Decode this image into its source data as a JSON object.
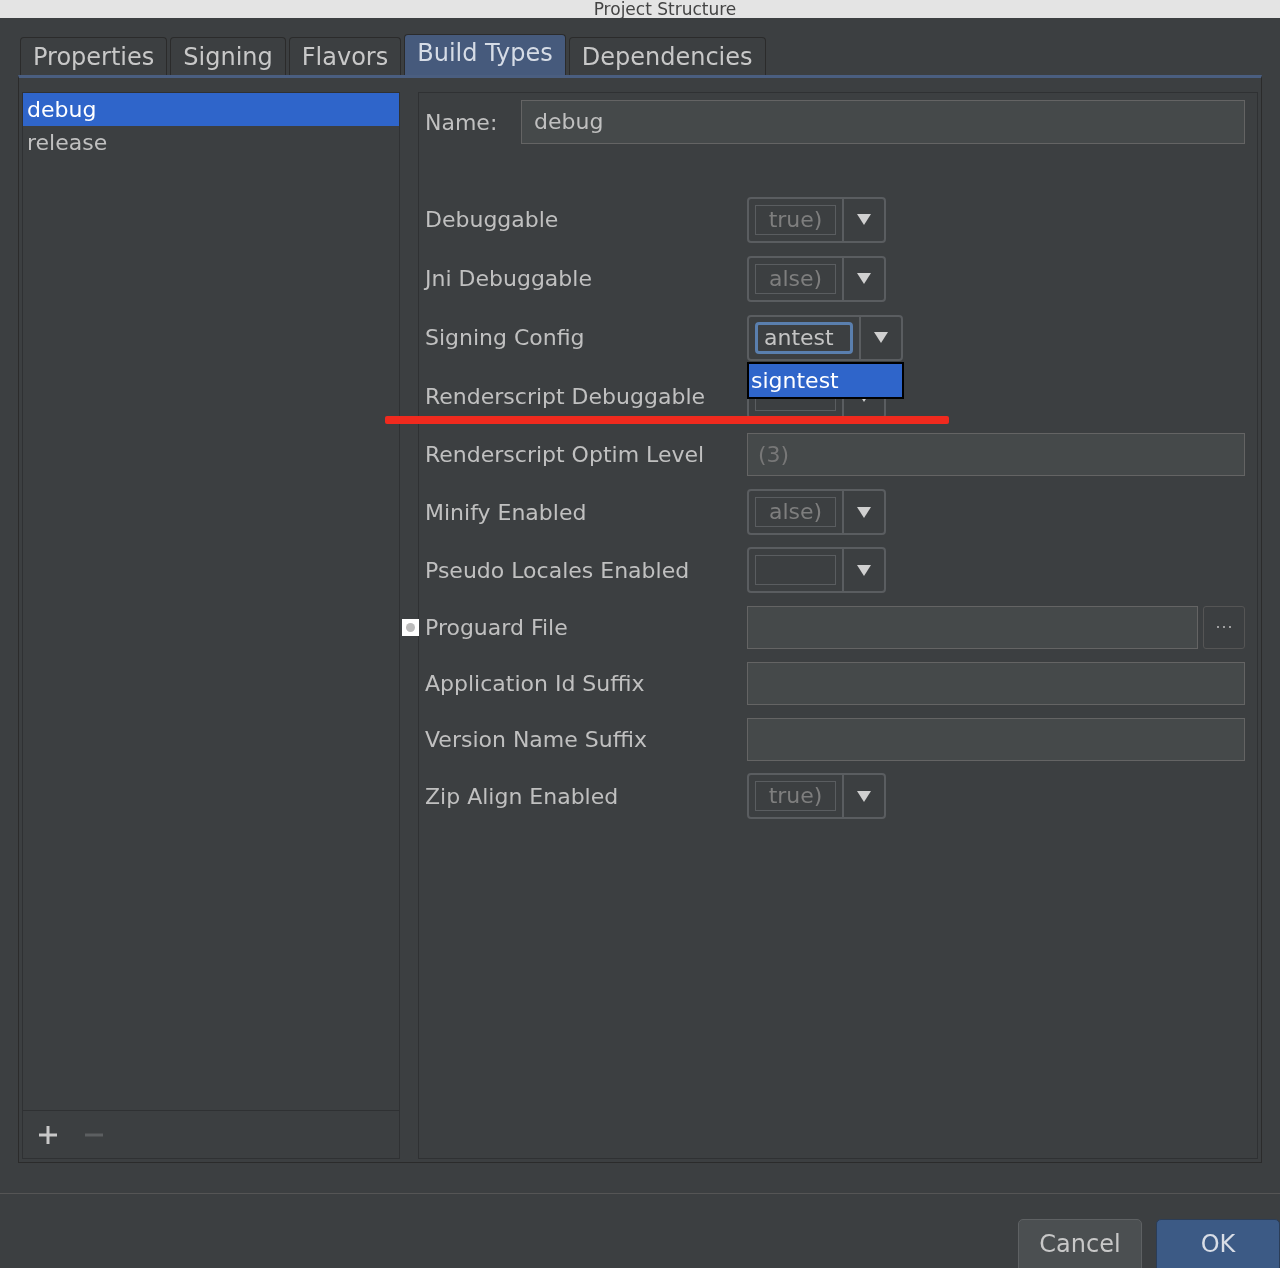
{
  "window": {
    "title": "Project Structure"
  },
  "tabs": [
    {
      "label": "Properties",
      "selected": false
    },
    {
      "label": "Signing",
      "selected": false
    },
    {
      "label": "Flavors",
      "selected": false
    },
    {
      "label": "Build Types",
      "selected": true
    },
    {
      "label": "Dependencies",
      "selected": false
    }
  ],
  "build_types": [
    {
      "label": "debug",
      "selected": true
    },
    {
      "label": "release",
      "selected": false
    }
  ],
  "list_toolbar": {
    "add_disabled": false,
    "remove_disabled": true
  },
  "name_field": {
    "label": "Name:",
    "value": "debug"
  },
  "fields": [
    {
      "label": "Debuggable",
      "kind": "select",
      "value": "true)"
    },
    {
      "label": "Jni Debuggable",
      "kind": "select",
      "value": "alse)"
    },
    {
      "label": "Signing Config",
      "kind": "select",
      "value": "antest",
      "focused": true,
      "dropdown": [
        {
          "label": "signtest",
          "selected": true
        }
      ]
    },
    {
      "label": "Renderscript Debuggable",
      "kind": "select"
    },
    {
      "label": "Renderscript Optim Level",
      "kind": "text",
      "placeholder": "(3)"
    },
    {
      "label": "Minify Enabled",
      "kind": "select",
      "value": "alse)"
    },
    {
      "label": "Pseudo Locales Enabled",
      "kind": "select"
    },
    {
      "label": "Proguard File",
      "kind": "file"
    },
    {
      "label": "Application Id Suffix",
      "kind": "text"
    },
    {
      "label": "Version Name Suffix",
      "kind": "text"
    },
    {
      "label": "Zip Align Enabled",
      "kind": "select",
      "value": "true)"
    }
  ],
  "buttons": [
    {
      "label": "Cancel",
      "default": false
    },
    {
      "label": "OK",
      "default": true
    }
  ]
}
